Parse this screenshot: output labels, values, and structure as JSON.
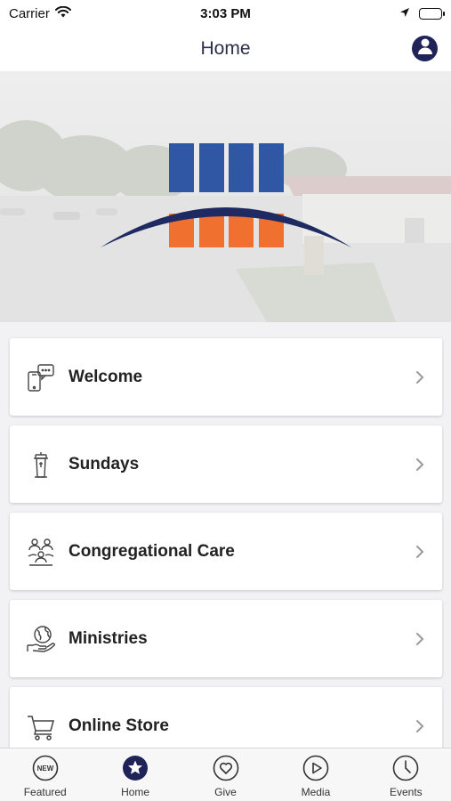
{
  "status_bar": {
    "carrier": "Carrier",
    "time": "3:03 PM"
  },
  "nav": {
    "title": "Home"
  },
  "colors": {
    "navy": "#1f2358",
    "logo_blue": "#2f57a3",
    "logo_orange": "#f07030"
  },
  "menu": [
    {
      "label": "Welcome",
      "icon": "phone-chat-icon"
    },
    {
      "label": "Sundays",
      "icon": "pulpit-icon"
    },
    {
      "label": "Congregational Care",
      "icon": "people-care-icon"
    },
    {
      "label": "Ministries",
      "icon": "globe-hand-icon"
    },
    {
      "label": "Online Store",
      "icon": "cart-icon"
    }
  ],
  "tabs": [
    {
      "label": "Featured",
      "icon": "new-badge-icon",
      "badge_text": "NEW"
    },
    {
      "label": "Home",
      "icon": "star-icon",
      "active": true
    },
    {
      "label": "Give",
      "icon": "heart-icon"
    },
    {
      "label": "Media",
      "icon": "play-icon"
    },
    {
      "label": "Events",
      "icon": "clock-icon"
    }
  ]
}
